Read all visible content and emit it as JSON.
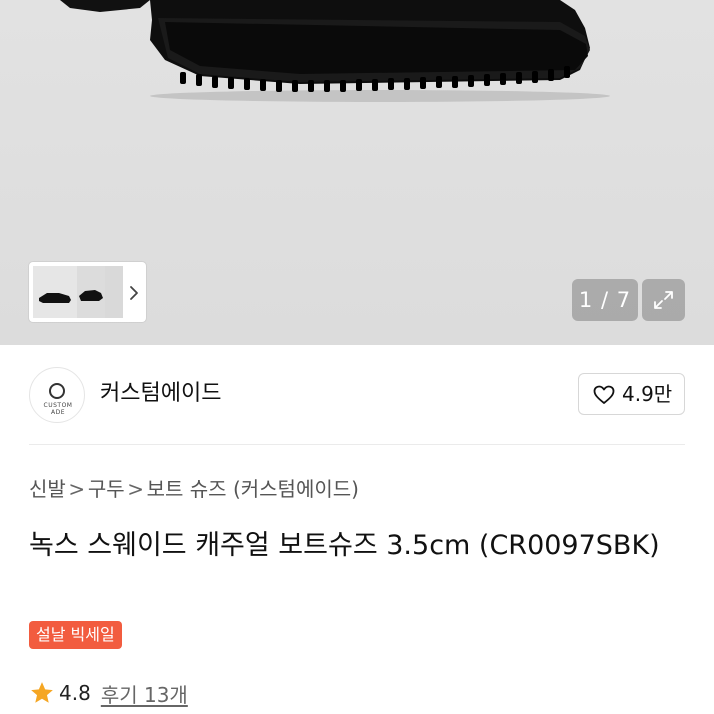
{
  "gallery": {
    "counter": "1 / 7",
    "icons": {
      "expand": "expand-icon",
      "next": "chevron-right-icon"
    }
  },
  "store": {
    "name": "커스텀에이드",
    "logo_text": "CUSTOM ADE",
    "favorites": "4.9만",
    "favorite_icon": "heart-icon"
  },
  "breadcrumb": {
    "items": [
      "신발",
      "구두",
      "보트 슈즈 (커스텀에이드)"
    ],
    "separator": ">"
  },
  "product": {
    "title": "녹스 스웨이드 캐주얼 보트슈즈 3.5cm (CR0097SBK)",
    "badge": "설날 빅세일",
    "badge_color": "#f25c3f",
    "rating": "4.8",
    "reviews": "후기 13개",
    "star_color": "#f5a623"
  }
}
